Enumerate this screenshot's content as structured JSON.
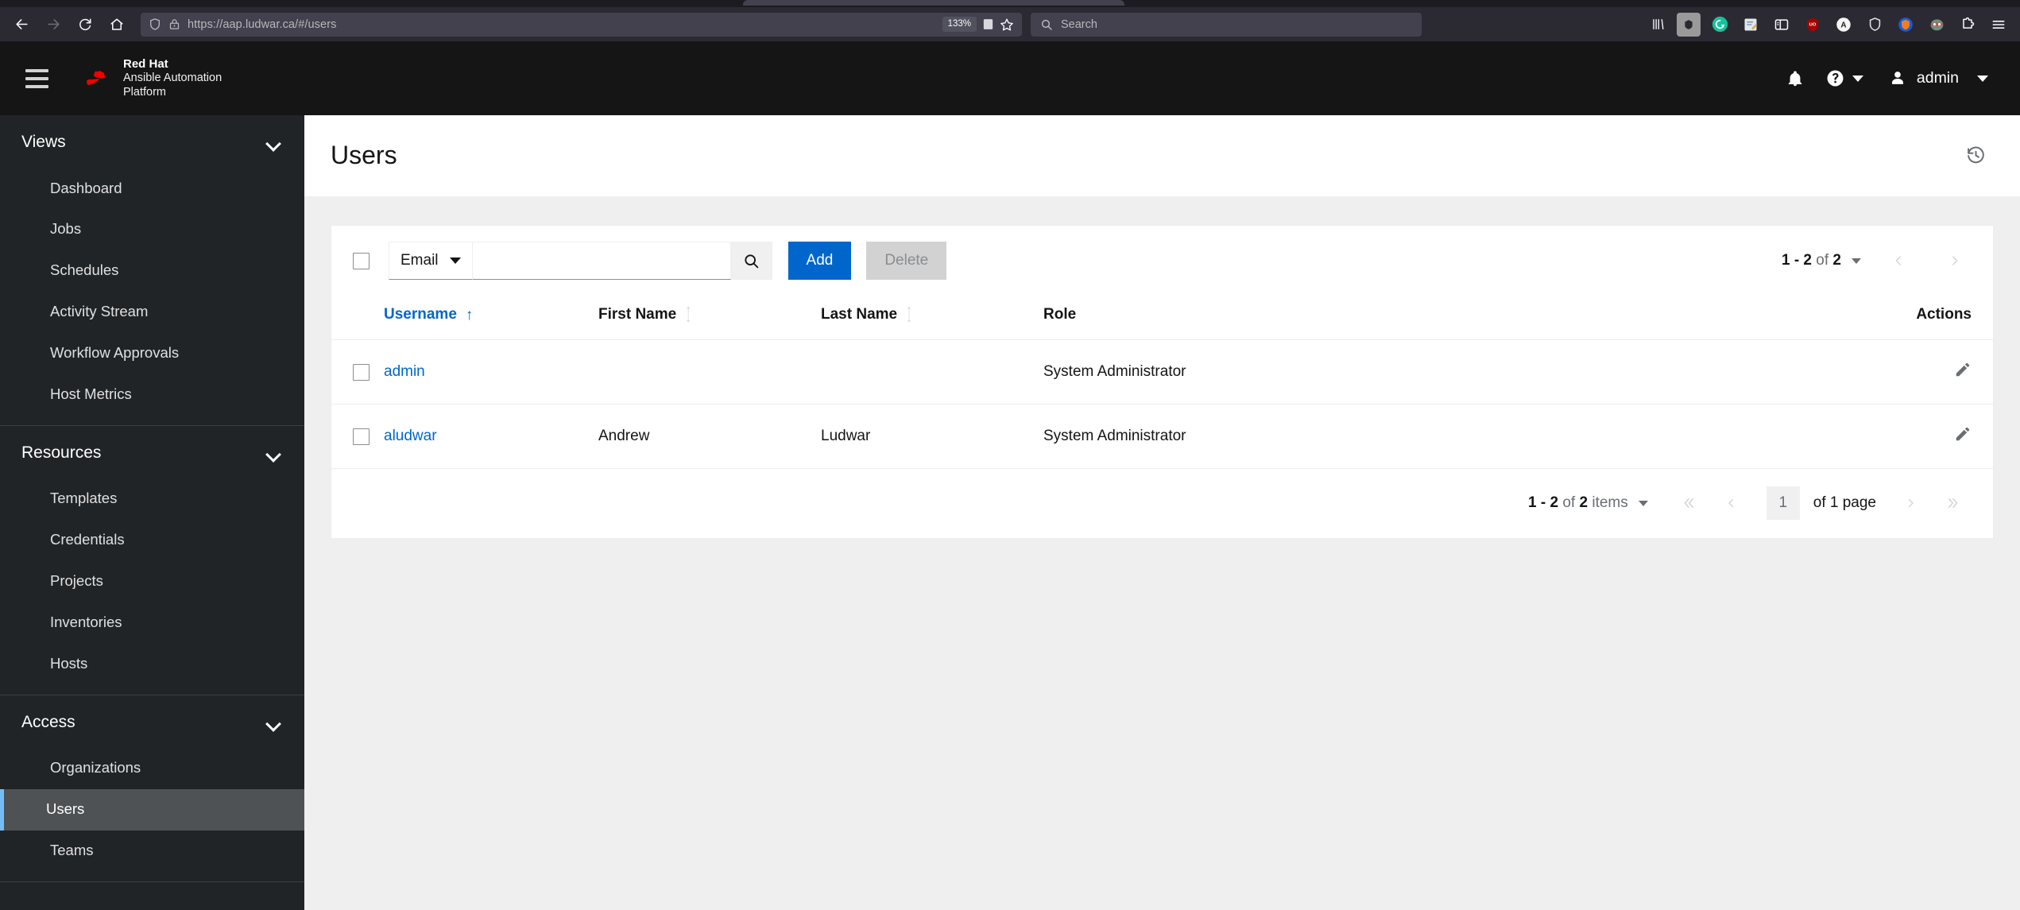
{
  "browser": {
    "nav": {
      "back": "back-arrow",
      "forward": "forward-arrow",
      "reload": "reload",
      "home": "home"
    },
    "url": "https://aap.ludwar.ca/#/users",
    "zoom_level": "133%",
    "search_placeholder": "Search",
    "extensions": [
      "library-icon",
      "adblock-icon",
      "grammarly-icon",
      "notes-icon",
      "sidebar-icon",
      "shield-red-icon",
      "a-circle-icon",
      "shield-outline-icon",
      "bitwarden-icon",
      "privacy-badger-icon",
      "puzzle-icon",
      "app-menu-icon"
    ]
  },
  "masthead": {
    "brand_line1": "Red Hat",
    "brand_line2": "Ansible Automation",
    "brand_line3": "Platform",
    "username": "admin"
  },
  "sidebar": {
    "groups": [
      {
        "title": "Views",
        "items": [
          {
            "label": "Dashboard",
            "active": false
          },
          {
            "label": "Jobs",
            "active": false
          },
          {
            "label": "Schedules",
            "active": false
          },
          {
            "label": "Activity Stream",
            "active": false
          },
          {
            "label": "Workflow Approvals",
            "active": false
          },
          {
            "label": "Host Metrics",
            "active": false
          }
        ]
      },
      {
        "title": "Resources",
        "items": [
          {
            "label": "Templates",
            "active": false
          },
          {
            "label": "Credentials",
            "active": false
          },
          {
            "label": "Projects",
            "active": false
          },
          {
            "label": "Inventories",
            "active": false
          },
          {
            "label": "Hosts",
            "active": false
          }
        ]
      },
      {
        "title": "Access",
        "items": [
          {
            "label": "Organizations",
            "active": false
          },
          {
            "label": "Users",
            "active": true
          },
          {
            "label": "Teams",
            "active": false
          }
        ]
      }
    ]
  },
  "page": {
    "title": "Users"
  },
  "toolbar": {
    "filter_attribute": "Email",
    "search_value": "",
    "search_placeholder": "",
    "add_label": "Add",
    "delete_label": "Delete",
    "pagination_summary": "1 - 2 of 2",
    "pagination_range": "1 - 2",
    "pagination_of": "of",
    "pagination_total": "2"
  },
  "table": {
    "columns": [
      {
        "key": "username",
        "label": "Username",
        "sort": "asc"
      },
      {
        "key": "first_name",
        "label": "First Name",
        "sort": "none"
      },
      {
        "key": "last_name",
        "label": "Last Name",
        "sort": "none"
      },
      {
        "key": "role",
        "label": "Role",
        "sort": null
      },
      {
        "key": "actions",
        "label": "Actions",
        "sort": null
      }
    ],
    "rows": [
      {
        "username": "admin",
        "first_name": "",
        "last_name": "",
        "role": "System Administrator",
        "action": "edit-pencil-icon"
      },
      {
        "username": "aludwar",
        "first_name": "Andrew",
        "last_name": "Ludwar",
        "role": "System Administrator",
        "action": "edit-pencil-icon"
      }
    ]
  },
  "footer": {
    "items_range": "1 - 2",
    "items_of": "of",
    "items_total": "2",
    "items_word": "items",
    "items_summary": "1 - 2 of 2 items",
    "page_number": "1",
    "of_pages": "of 1 page"
  },
  "colors": {
    "brand_red": "#ee0000",
    "primary_blue": "#0066cc",
    "link_blue": "#06c",
    "active_border": "#73bcf7",
    "masthead_bg": "#151515",
    "sidebar_bg": "#212427",
    "page_bg": "#efefef"
  }
}
